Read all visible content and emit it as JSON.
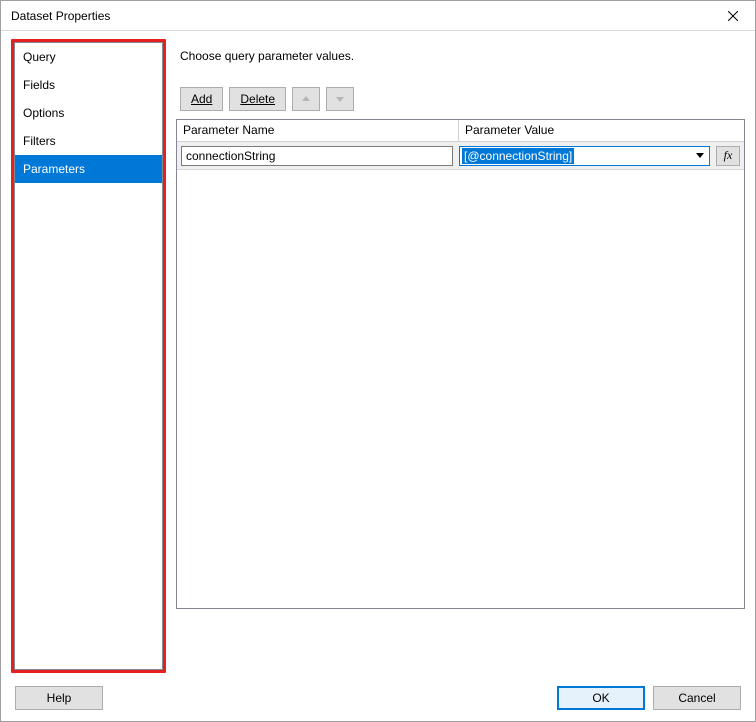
{
  "window": {
    "title": "Dataset Properties"
  },
  "sidebar": {
    "items": [
      {
        "label": "Query",
        "active": false
      },
      {
        "label": "Fields",
        "active": false
      },
      {
        "label": "Options",
        "active": false
      },
      {
        "label": "Filters",
        "active": false
      },
      {
        "label": "Parameters",
        "active": true
      }
    ]
  },
  "content": {
    "heading": "Choose query parameter values.",
    "toolbar": {
      "add_label": "Add",
      "delete_label": "Delete"
    },
    "grid": {
      "columns": {
        "name": "Parameter Name",
        "value": "Parameter Value"
      },
      "rows": [
        {
          "name": "connectionString",
          "value": "[@connectionString]"
        }
      ]
    }
  },
  "footer": {
    "help_label": "Help",
    "ok_label": "OK",
    "cancel_label": "Cancel"
  },
  "icons": {
    "fx": "fx"
  }
}
